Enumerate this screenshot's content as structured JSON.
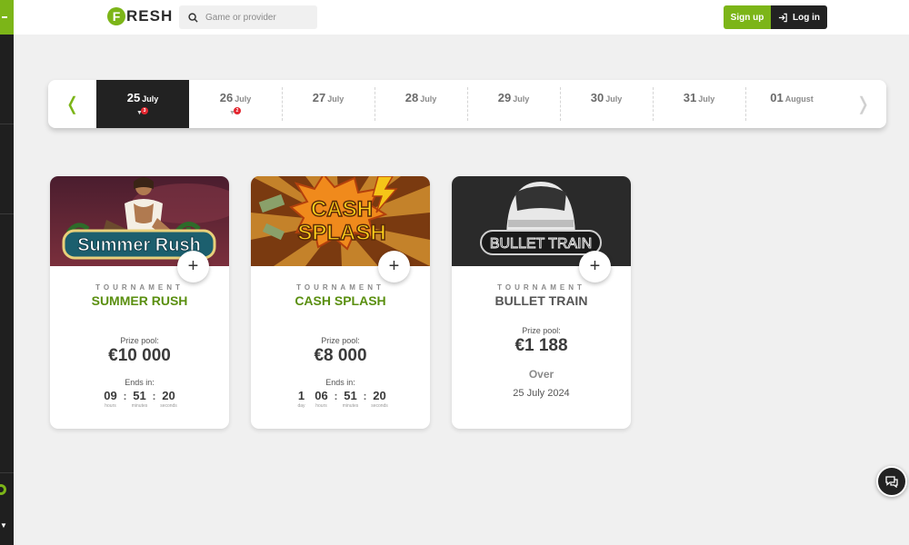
{
  "header": {
    "logo_first_letter": "F",
    "logo_rest": "RESH",
    "search_placeholder": "Game or provider",
    "signup_label": "Sign up",
    "login_label": "Log in"
  },
  "calendar": {
    "days": [
      {
        "num": "25",
        "month": "July",
        "badge": "3",
        "active": true
      },
      {
        "num": "26",
        "month": "July",
        "badge": "2",
        "active": false
      },
      {
        "num": "27",
        "month": "July"
      },
      {
        "num": "28",
        "month": "July"
      },
      {
        "num": "29",
        "month": "July"
      },
      {
        "num": "30",
        "month": "July"
      },
      {
        "num": "31",
        "month": "July"
      },
      {
        "num": "01",
        "month": "August"
      }
    ]
  },
  "tournaments": [
    {
      "kicker": "TOURNAMENT",
      "name": "SUMMER RUSH",
      "banner_text": "Summer Rush",
      "prize_label": "Prize pool:",
      "prize": "€10 000",
      "ends_label": "Ends in:",
      "timer": [
        {
          "value": "09",
          "unit": "hours"
        },
        {
          "value": "51",
          "unit": "minutes"
        },
        {
          "value": "20",
          "unit": "seconds"
        }
      ]
    },
    {
      "kicker": "TOURNAMENT",
      "name": "CASH SPLASH",
      "banner_text_1": "CASH",
      "banner_text_2": "SPLASH",
      "prize_label": "Prize pool:",
      "prize": "€8 000",
      "ends_label": "Ends in:",
      "timer": [
        {
          "value": "1",
          "unit": "day"
        },
        {
          "value": "06",
          "unit": "hours"
        },
        {
          "value": "51",
          "unit": "minutes"
        },
        {
          "value": "20",
          "unit": "seconds"
        }
      ]
    },
    {
      "kicker": "TOURNAMENT",
      "name": "BULLET TRAIN",
      "banner_text": "BULLET TRAIN",
      "prize_label": "Prize pool:",
      "prize": "€1 188",
      "status": "Over",
      "end_date": "25 July 2024"
    }
  ],
  "colors": {
    "brand_green": "#7cb518",
    "dark": "#222222",
    "badge_red": "#e3262f",
    "tournament_name_green": "#5a8f10"
  },
  "icons": [
    "search-icon",
    "login-icon",
    "trophy-icon",
    "chevron-left-icon",
    "chevron-right-icon",
    "plus-icon",
    "chat-icon"
  ]
}
